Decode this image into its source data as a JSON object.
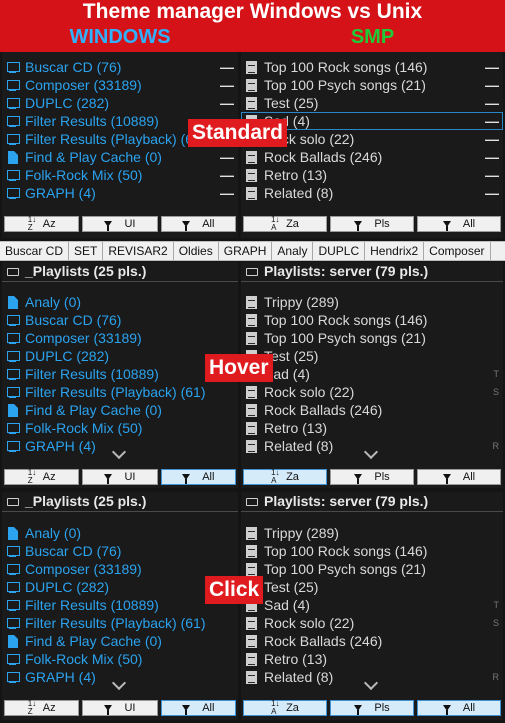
{
  "banner": {
    "title": "Theme manager Windows vs Unix",
    "left": "WINDOWS",
    "right": "SMP"
  },
  "tags": {
    "standard": "Standard",
    "hover": "Hover",
    "click": "Click"
  },
  "tabs": [
    "Buscar CD",
    "SET",
    "REVISAR2",
    "Oldies",
    "GRAPH",
    "Analy",
    "DUPLC",
    "Hendrix2",
    "Composer"
  ],
  "left_header": "_Playlists (25 pls.)",
  "right_header": "Playlists: server (79 pls.)",
  "left_items_top": [
    {
      "label": "Buscar CD (76)",
      "icon": "monitor-icon"
    },
    {
      "label": "Composer (33189)",
      "icon": "monitor-icon"
    },
    {
      "label": "DUPLC (282)",
      "icon": "monitor-icon"
    },
    {
      "label": "Filter Results (10889)",
      "icon": "monitor-icon"
    },
    {
      "label": "Filter Results (Playback) (61)",
      "icon": "monitor-icon"
    },
    {
      "label": "Find & Play Cache (0)",
      "icon": "file-icon"
    },
    {
      "label": "Folk-Rock Mix (50)",
      "icon": "monitor-icon"
    },
    {
      "label": "GRAPH (4)",
      "icon": "monitor-icon"
    }
  ],
  "left_items": [
    {
      "label": "Analy (0)",
      "icon": "file-icon"
    },
    {
      "label": "Buscar CD (76)",
      "icon": "monitor-icon"
    },
    {
      "label": "Composer (33189)",
      "icon": "monitor-icon"
    },
    {
      "label": "DUPLC (282)",
      "icon": "monitor-icon"
    },
    {
      "label": "Filter Results (10889)",
      "icon": "monitor-icon"
    },
    {
      "label": "Filter Results (Playback) (61)",
      "icon": "monitor-icon"
    },
    {
      "label": "Find & Play Cache (0)",
      "icon": "file-icon"
    },
    {
      "label": "Folk-Rock Mix (50)",
      "icon": "monitor-icon"
    },
    {
      "label": "GRAPH (4)",
      "icon": "monitor-icon"
    }
  ],
  "right_items_top": [
    "Top 100 Rock songs (146)",
    "Top 100 Psych songs (21)",
    "Test (25)",
    "Sad (4)",
    "Rock solo (22)",
    "Rock Ballads (246)",
    "Retro (13)",
    "Related (8)"
  ],
  "right_items": [
    "Trippy (289)",
    "Top 100 Rock songs (146)",
    "Top 100 Psych songs (21)",
    "Test (25)",
    "Sad (4)",
    "Rock solo (22)",
    "Rock Ballads (246)",
    "Retro (13)",
    "Related (8)"
  ],
  "right_letters": {
    "T": "T",
    "S": "S",
    "R": "R"
  },
  "left_buttons": {
    "sort": "Az",
    "ui": "UI",
    "all": "All"
  },
  "right_buttons": {
    "sort": "Za",
    "pls": "Pls",
    "all": "All"
  },
  "sort_glyph_left": "1↓Z",
  "sort_glyph_right": "1↓A",
  "dash": "—"
}
